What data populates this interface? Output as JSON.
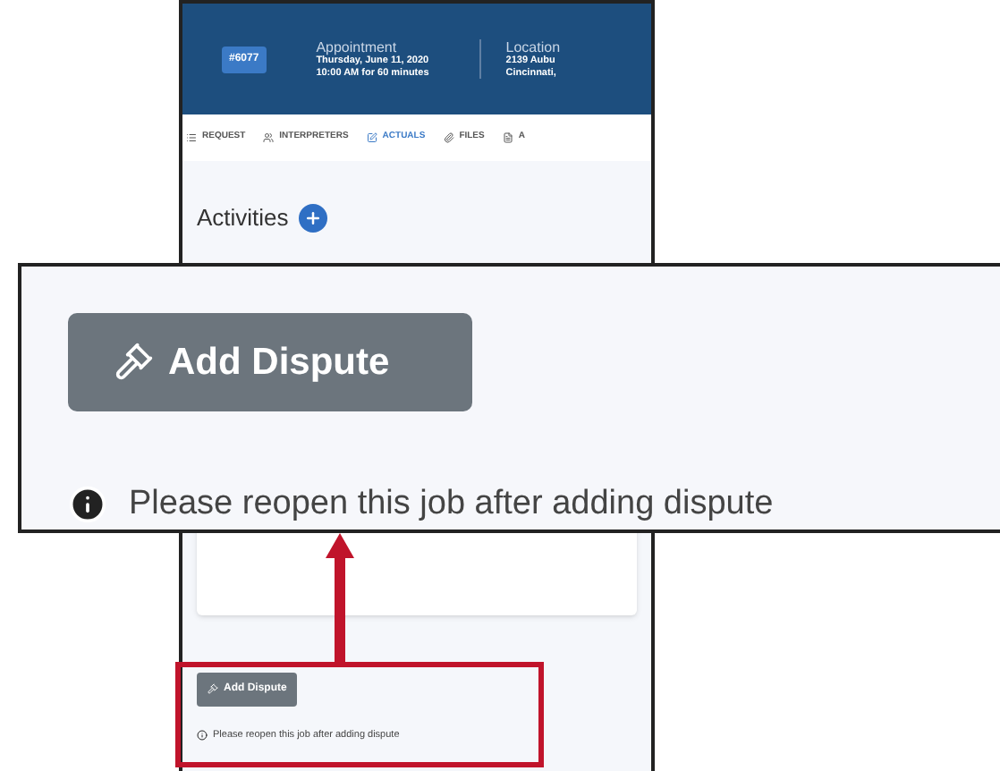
{
  "header": {
    "job_number": "#6077",
    "appointment": {
      "title": "Appointment",
      "date": "Thursday, June 11, 2020",
      "time": "10:00 AM for 60 minutes"
    },
    "location": {
      "title": "Location",
      "line_1": "2139 Aubu",
      "line_2": "Cincinnati,"
    }
  },
  "tabs": [
    {
      "label": "REQUEST",
      "selected": false
    },
    {
      "label": "INTERPRETERS",
      "selected": false
    },
    {
      "label": "ACTUALS",
      "selected": true
    },
    {
      "label": "FILES",
      "selected": false
    },
    {
      "label": "A",
      "selected": false
    }
  ],
  "activities": {
    "title": "Activities"
  },
  "screen_footer": {
    "button": "Add Dispute",
    "note": "Please reopen this job after adding dispute"
  },
  "callout": {
    "button": "Add Dispute",
    "note": "Please reopen this job after adding dispute"
  }
}
